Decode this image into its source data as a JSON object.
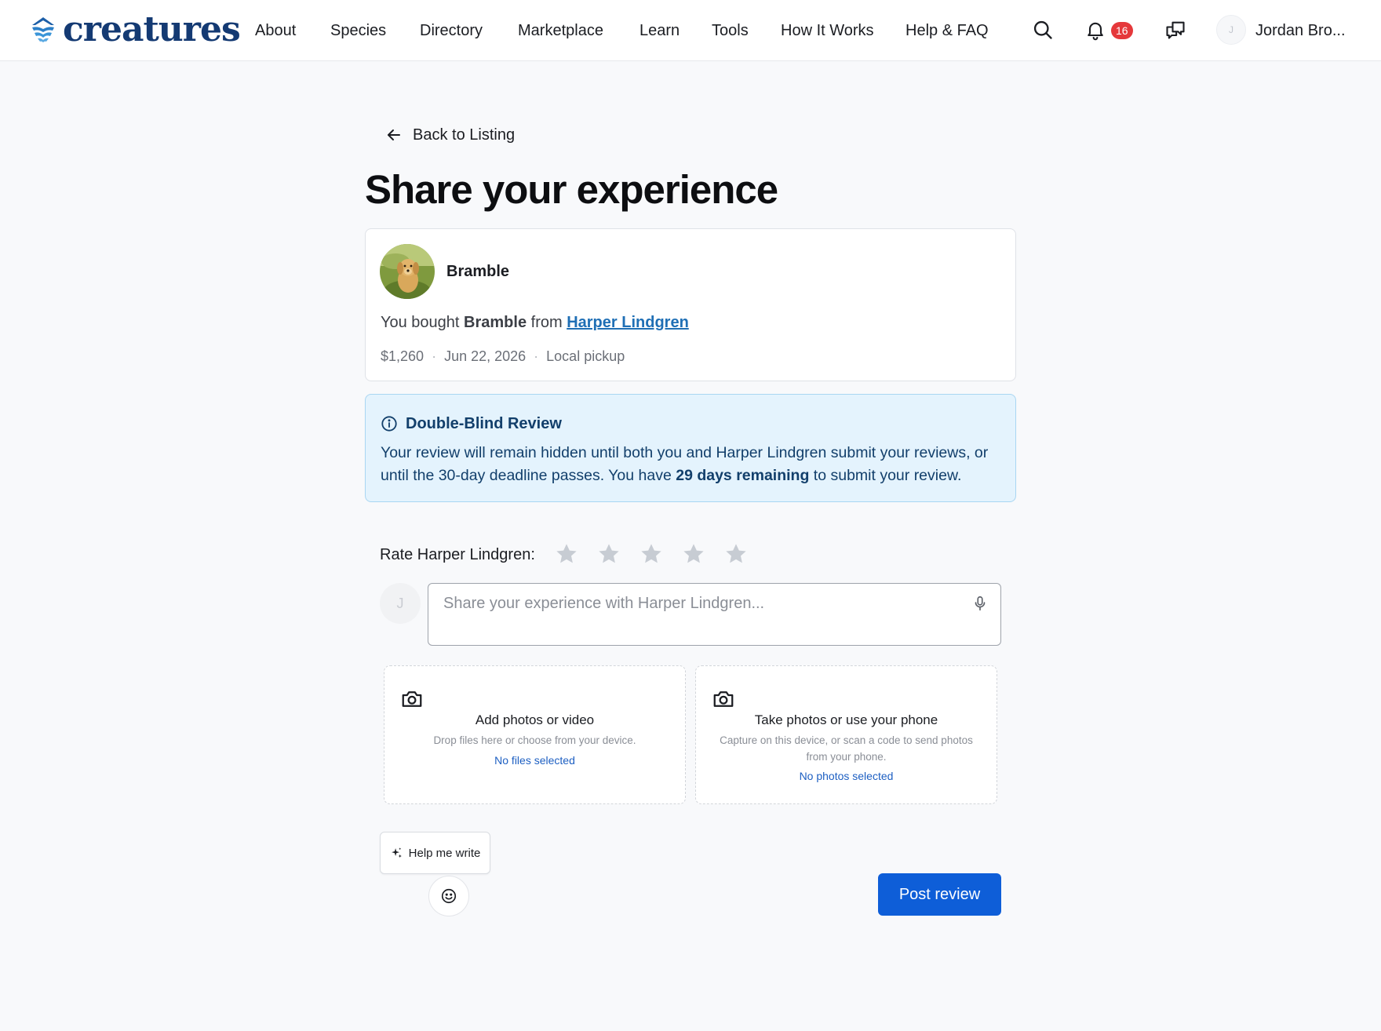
{
  "brand": {
    "name": "creatures",
    "color": "#143a73"
  },
  "nav": {
    "items": [
      "About",
      "Species",
      "Directory",
      "Marketplace",
      "Learn",
      "Tools",
      "How It Works",
      "Help & FAQ"
    ],
    "notifications_count": "16",
    "user_initial": "J",
    "user_name": "Jordan Bro..."
  },
  "page": {
    "back_label": "Back to Listing",
    "title": "Share your experience"
  },
  "purchase": {
    "pet_name": "Bramble",
    "bought_prefix": "You bought ",
    "bought_item": "Bramble",
    "bought_from": " from ",
    "seller": "Harper Lindgren",
    "price": "$1,260",
    "date": "Jun 22, 2026",
    "delivery": "Local pickup",
    "separator": "·"
  },
  "notice": {
    "title": "Double-Blind Review",
    "text_before": "Your review will remain hidden until both you and Harper Lindgren submit your reviews, or until the 30-day deadline passes. You have ",
    "text_bold": "29 days remaining",
    "text_after": " to submit your review."
  },
  "rating": {
    "label": "Rate Harper Lindgren:",
    "max": 5,
    "value": 0,
    "empty_color": "#c7ccd3"
  },
  "review": {
    "avatar_initial": "J",
    "placeholder": "Share your experience with Harper Lindgren..."
  },
  "uploads": {
    "files": {
      "title": "Add photos or video",
      "subtitle": "Drop files here or choose from your device.",
      "status": "No files selected"
    },
    "phone": {
      "title": "Take photos or use your phone",
      "subtitle": "Capture on this device, or scan a code to send photos from your phone.",
      "status": "No photos selected"
    }
  },
  "actions": {
    "help_label": "Help me write",
    "post_label": "Post review",
    "post_color": "#0e5ed8"
  },
  "colors": {
    "notice_bg": "#e4f3fd",
    "link": "#1f6fb5",
    "badge": "#e5383b"
  }
}
